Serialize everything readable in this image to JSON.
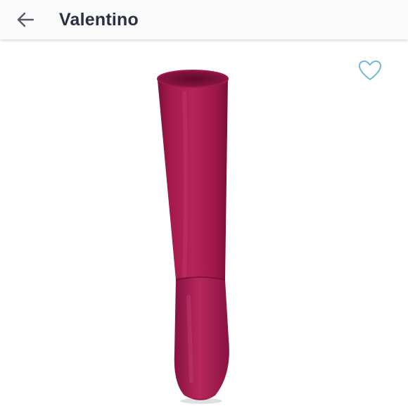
{
  "header": {
    "title": "Valentino",
    "back_icon": "arrow-left-icon"
  },
  "product": {
    "favorite_icon": "heart-outline-icon",
    "boot_color": "#a3174a",
    "accent_color": "#6fb8d6"
  }
}
